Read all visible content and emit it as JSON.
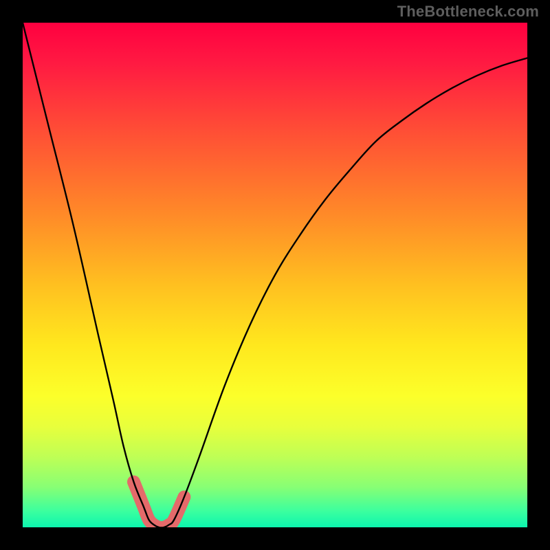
{
  "attribution": "TheBottleneck.com",
  "chart_data": {
    "type": "line",
    "title": "",
    "xlabel": "",
    "ylabel": "",
    "xlim": [
      0,
      100
    ],
    "ylim": [
      0,
      100
    ],
    "series": [
      {
        "name": "bottleneck-curve",
        "x": [
          0,
          5,
          10,
          15,
          18,
          20,
          22,
          24,
          25,
          26,
          27,
          28,
          29,
          30,
          32,
          35,
          40,
          45,
          50,
          55,
          60,
          65,
          70,
          75,
          80,
          85,
          90,
          95,
          100
        ],
        "values": [
          100,
          80,
          60,
          38,
          25,
          16,
          9,
          4,
          1.5,
          0.5,
          0,
          0,
          0.5,
          1.5,
          6,
          14,
          28,
          40,
          50,
          58,
          65,
          71,
          76.5,
          80.5,
          84,
          87,
          89.5,
          91.5,
          93
        ]
      }
    ],
    "annotations": [
      {
        "name": "valley-highlight",
        "x_range": [
          23,
          31
        ],
        "color": "#e46a6a"
      }
    ],
    "gradient_stops": [
      {
        "pos": 0.0,
        "color": "#ff0040"
      },
      {
        "pos": 0.25,
        "color": "#ff6a2e"
      },
      {
        "pos": 0.5,
        "color": "#ffc020"
      },
      {
        "pos": 0.75,
        "color": "#f4ff2e"
      },
      {
        "pos": 1.0,
        "color": "#0cf5ae"
      }
    ]
  }
}
